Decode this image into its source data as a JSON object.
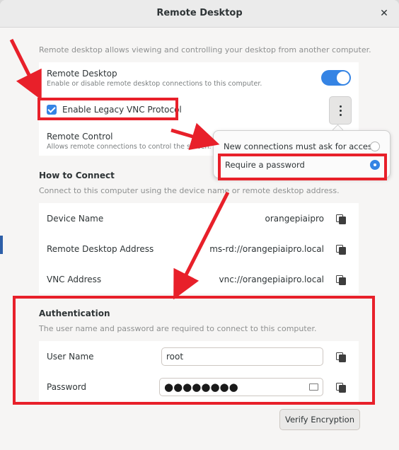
{
  "window": {
    "title": "Remote Desktop",
    "close_glyph": "✕"
  },
  "intro": "Remote desktop allows viewing and controlling your desktop from another computer.",
  "remote_desktop": {
    "label": "Remote Desktop",
    "sub": "Enable or disable remote desktop connections to this computer.",
    "toggle_on": true
  },
  "legacy_vnc": {
    "label": "Enable Legacy VNC Protocol",
    "checked": true
  },
  "remote_control": {
    "label": "Remote Control",
    "sub": "Allows remote connections to control the screen."
  },
  "popover": {
    "options": [
      {
        "label": "New connections must ask for access",
        "selected": false
      },
      {
        "label": "Require a password",
        "selected": true
      }
    ]
  },
  "how_to_connect": {
    "heading": "How to Connect",
    "desc": "Connect to this computer using the device name or remote desktop address.",
    "rows": [
      {
        "label": "Device Name",
        "value": "orangepiaipro"
      },
      {
        "label": "Remote Desktop Address",
        "value": "ms-rd://orangepiaipro.local"
      },
      {
        "label": "VNC Address",
        "value": "vnc://orangepiaipro.local"
      }
    ]
  },
  "authentication": {
    "heading": "Authentication",
    "desc": "The user name and password are required to connect to this computer.",
    "username_label": "User Name",
    "username_value": "root",
    "password_label": "Password",
    "password_mask": "●●●●●●●●"
  },
  "verify_button": "Verify Encryption",
  "colors": {
    "accent": "#3584e4",
    "annotation_red": "#e8202a"
  },
  "icons": [
    "close-icon",
    "kebab-menu-icon",
    "copy-icon",
    "keyboard-icon",
    "checkbox-checked-icon",
    "radio-icon"
  ]
}
